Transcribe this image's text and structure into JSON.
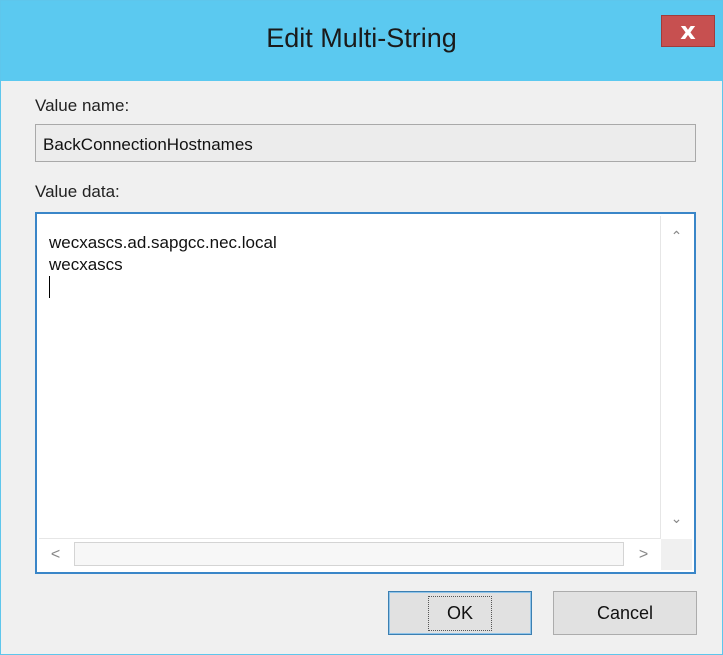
{
  "dialog": {
    "title": "Edit Multi-String",
    "close_glyph": "x"
  },
  "value_name": {
    "label": "Value name:",
    "value": "BackConnectionHostnames"
  },
  "value_data": {
    "label": "Value data:",
    "lines": [
      "wecxascs.ad.sapgcc.nec.local",
      "wecxascs"
    ]
  },
  "scrollbars": {
    "up": "⌃",
    "down": "⌄",
    "left": "<",
    "right": ">"
  },
  "buttons": {
    "ok": "OK",
    "cancel": "Cancel"
  },
  "colors": {
    "titlebar": "#5bc9f0",
    "close": "#c75050",
    "focus_border": "#3a86c8"
  }
}
